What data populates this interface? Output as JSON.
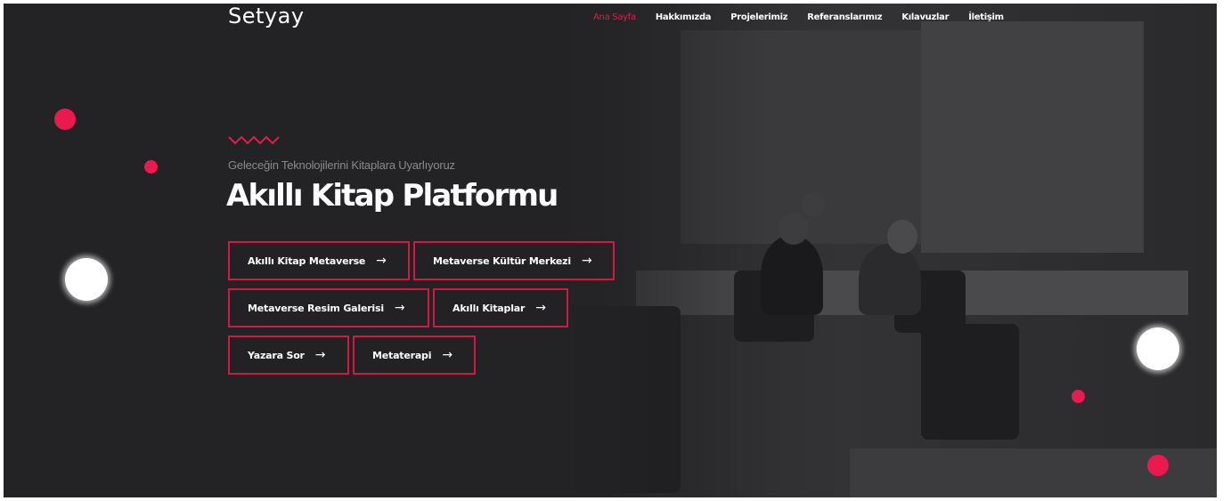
{
  "header": {
    "logo": "Setyay",
    "nav": [
      {
        "label": "Ana Sayfa",
        "active": true
      },
      {
        "label": "Hakkımızda",
        "active": false
      },
      {
        "label": "Projelerimiz",
        "active": false
      },
      {
        "label": "Referanslarımız",
        "active": false
      },
      {
        "label": "Kılavuzlar",
        "active": false
      },
      {
        "label": "İletişim",
        "active": false
      }
    ]
  },
  "hero": {
    "subtitle": "Geleceğin Teknolojilerini Kitaplara Uyarlıyoruz",
    "title": "Akıllı Kitap Platformu",
    "buttons": [
      {
        "label": "Akıllı Kitap Metaverse",
        "arrow": "→"
      },
      {
        "label": "Metaverse Kültür Merkezi",
        "arrow": "→"
      },
      {
        "label": "Metaverse Resim Galerisi",
        "arrow": "→"
      },
      {
        "label": "Akıllı Kitaplar",
        "arrow": "→"
      },
      {
        "label": "Yazara Sor",
        "arrow": "→"
      },
      {
        "label": "Metaterapi",
        "arrow": "→"
      }
    ]
  },
  "colors": {
    "background": "#232325",
    "accent": "#e8194b",
    "text": "#ffffff",
    "muted": "#8a8a8c"
  }
}
